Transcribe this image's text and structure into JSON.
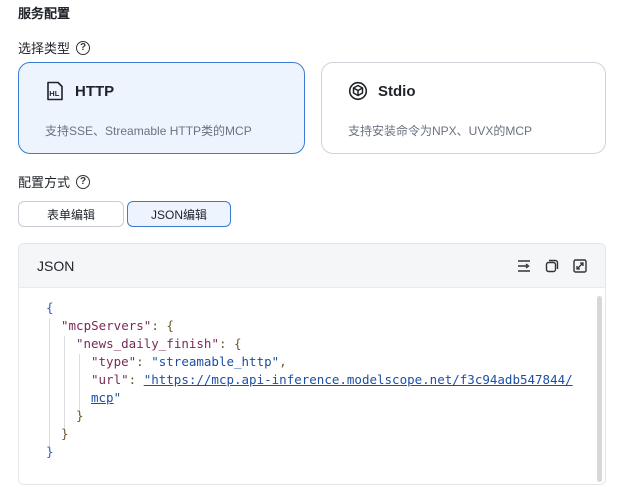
{
  "section_title": "服务配置",
  "type_label": "选择类型",
  "types": [
    {
      "title": "HTTP",
      "desc": "支持SSE、Streamable HTTP类的MCP",
      "icon": "http-file-icon",
      "selected": true
    },
    {
      "title": "Stdio",
      "desc": "支持安装命令为NPX、UVX的MCP",
      "icon": "stdio-package-icon",
      "selected": false
    }
  ],
  "config_label": "配置方式",
  "modes": [
    {
      "label": "表单编辑",
      "active": false
    },
    {
      "label": "JSON编辑",
      "active": true
    }
  ],
  "editor": {
    "title": "JSON",
    "tools": [
      "format-icon",
      "copy-icon",
      "expand-icon"
    ],
    "code": {
      "open_brace": "{",
      "mcp_key": "\"mcpServers\"",
      "colon_brace_1": ": {",
      "server_key": "\"news_daily_finish\"",
      "colon_brace_2": ": {",
      "type_key": "\"type\"",
      "type_sep": ": ",
      "type_value": "\"streamable_http\"",
      "type_comma": ",",
      "url_key": "\"url\"",
      "url_sep": ": ",
      "url_value_1": "\"https://mcp.api-inference.modelscope.net/f3c94adb547844/",
      "url_value_2": "mcp",
      "url_close_quote": "\"",
      "close_inner": "}",
      "close_mid": "}",
      "close_outer": "}"
    }
  },
  "colors": {
    "accent": "#3a7bd5",
    "selected_bg": "#eef4fd"
  }
}
